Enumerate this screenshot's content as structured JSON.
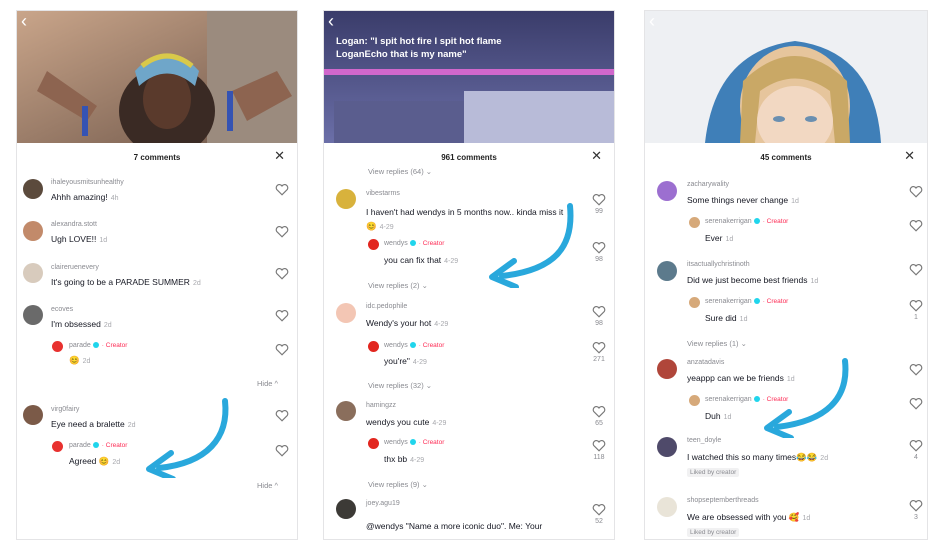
{
  "accent": "#29a8dc",
  "creator_color": "#fe2c55",
  "panels": [
    {
      "comment_count": "7 comments",
      "comments": [
        {
          "user": "ihaleyousmitsunhealthy",
          "text": "Ahhh amazing!",
          "date": "4h"
        },
        {
          "user": "alexandra.stott",
          "text": "Ugh LOVE!!",
          "date": "1d"
        },
        {
          "user": "claireruenevery",
          "text": "It's going to be a PARADE SUMMER",
          "date": "2d"
        },
        {
          "user": "ecoves",
          "text": "I'm obsessed",
          "date": "2d"
        },
        {
          "user": "parade",
          "creator": "· Creator",
          "text": "😊",
          "date": "2d"
        },
        {
          "user": "virg0fairy",
          "text": "Eye need a bralette",
          "date": "2d"
        },
        {
          "user": "parade",
          "creator": "· Creator",
          "text": "Agreed 😊",
          "date": "2d"
        }
      ],
      "hide_labels": [
        "Hide ^",
        "Hide ^"
      ]
    },
    {
      "caption": "Logan: \"I spit hot fire I spit hot flame LoganEcho that is my name\"",
      "comment_count": "961 comments",
      "top_link": "View replies (64) ⌄",
      "comments": [
        {
          "user": "vibestarms",
          "text": "I haven't had wendys in 5 months now.. kinda miss it 😊",
          "date": "4-29",
          "likes": "99"
        },
        {
          "user": "wendys",
          "creator": "· Creator",
          "text": "you can fix that",
          "date": "4-29",
          "likes": "98"
        },
        {
          "user": "idc.pedophile",
          "text": "Wendy's your hot",
          "date": "4-29",
          "likes": "98"
        },
        {
          "user": "wendys",
          "creator": "· Creator",
          "text": "you're\"",
          "date": "4-29",
          "likes": "271"
        },
        {
          "user": "hamingzz",
          "text": "wendys you cute",
          "date": "4-29",
          "likes": "65"
        },
        {
          "user": "wendys",
          "creator": "· Creator",
          "text": "thx bb",
          "date": "4-29",
          "likes": "118"
        },
        {
          "user": "joey.agu19",
          "text": "@wendys \"Name a more iconic duo\". Me: Your",
          "date": "",
          "likes": "52"
        }
      ],
      "view_links": [
        "View replies (2) ⌄",
        "View replies (32) ⌄",
        "View replies (9) ⌄"
      ]
    },
    {
      "comment_count": "45 comments",
      "comments": [
        {
          "user": "zacharywality",
          "text": "Some things never change",
          "date": "1d",
          "likes": ""
        },
        {
          "user": "serenakerrigan",
          "creator": "· Creator",
          "text": "Ever",
          "date": "1d",
          "likes": ""
        },
        {
          "user": "itsactuallychristinoth",
          "text": "Did we just become best friends",
          "date": "1d",
          "likes": ""
        },
        {
          "user": "serenakerrigan",
          "creator": "· Creator",
          "text": "Sure did",
          "date": "1d",
          "likes": "1"
        },
        {
          "user": "anzatadavis",
          "text": "yeappp can we be friends",
          "date": "1d",
          "likes": ""
        },
        {
          "user": "serenakerrigan",
          "creator": "· Creator",
          "text": "Duh",
          "date": "1d",
          "likes": ""
        },
        {
          "user": "teen_doyle",
          "text": "I watched this so many times😂😂",
          "date": "2d",
          "likes": "4"
        },
        {
          "user": "shopseptemberthreads",
          "text": "We are obsessed with you 🥰",
          "date": "1d",
          "likes": "3"
        }
      ],
      "view_link": "View replies (1) ⌄",
      "liked_label": "Liked by creator"
    }
  ]
}
